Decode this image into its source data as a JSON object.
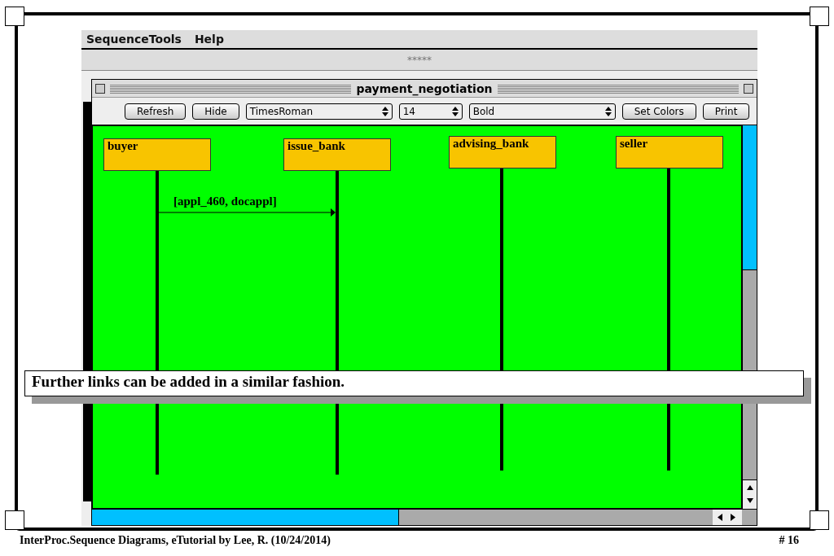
{
  "menu": [
    "SequenceTools",
    "Help"
  ],
  "app_title": "*****",
  "window": {
    "title": "payment_negotiation"
  },
  "toolbar": [
    {
      "kind": "button",
      "label": "Refresh"
    },
    {
      "kind": "button",
      "label": "Hide"
    },
    {
      "kind": "select",
      "label": "TimesRoman"
    },
    {
      "kind": "select",
      "label": "14"
    },
    {
      "kind": "select",
      "label": "Bold"
    },
    {
      "kind": "button",
      "label": "Set Colors"
    },
    {
      "kind": "button",
      "label": "Print"
    }
  ],
  "objects": [
    {
      "name": "buyer"
    },
    {
      "name": "issue_bank"
    },
    {
      "name": "advising_bank"
    },
    {
      "name": "seller"
    }
  ],
  "messages": [
    {
      "label": "[appl_460, docappl]"
    }
  ],
  "callout": "Further links can be added in a similar fashion.",
  "footer": {
    "left": "InterProc.Sequence Diagrams, eTutorial by Lee, R.  (10/24/2014)",
    "right": "# 16"
  }
}
